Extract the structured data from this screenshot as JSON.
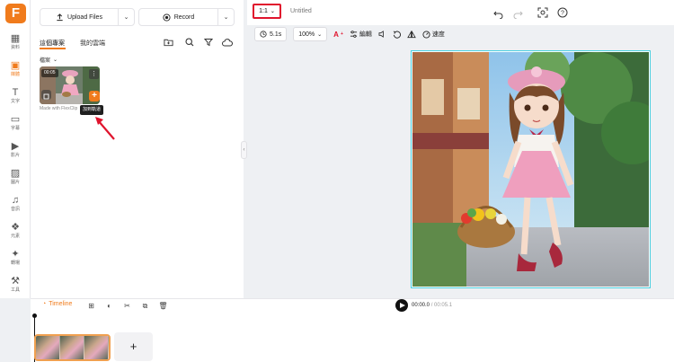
{
  "app": {
    "logo_letter": "F",
    "accent": "#f07b1c"
  },
  "rail": {
    "items": [
      {
        "icon": "grid-icon",
        "label": "資料",
        "glyph": "▦"
      },
      {
        "icon": "folder-icon",
        "label": "媒體",
        "glyph": "▣"
      },
      {
        "icon": "text-icon",
        "label": "文字",
        "glyph": "T"
      },
      {
        "icon": "subtitle-icon",
        "label": "字幕",
        "glyph": "▭"
      },
      {
        "icon": "video-icon",
        "label": "影片",
        "glyph": "▶"
      },
      {
        "icon": "image-icon",
        "label": "圖片",
        "glyph": "▨"
      },
      {
        "icon": "music-icon",
        "label": "音訊",
        "glyph": "♫"
      },
      {
        "icon": "elements-icon",
        "label": "元素",
        "glyph": "❖"
      },
      {
        "icon": "effects-icon",
        "label": "轉場",
        "glyph": "✦"
      },
      {
        "icon": "tools-icon",
        "label": "工具",
        "glyph": "⚒"
      }
    ]
  },
  "media": {
    "upload_label": "Upload Files",
    "record_label": "Record",
    "tabs": [
      "這個專案",
      "我的雲端"
    ],
    "filter_label": "檔案",
    "thumb_duration": "00:05",
    "thumb_caption": "Made with FlexClip",
    "tooltip": "加到軌道"
  },
  "topbar": {
    "ratio": "1:1",
    "title": "Untitled"
  },
  "toolbar": {
    "duration": "5.1s",
    "zoom": "100%",
    "edit_label": "編輯",
    "speed_label": "速度"
  },
  "timeline": {
    "label": "Timeline",
    "current": "00:00.0",
    "total": "/ 00:05.1",
    "add_label": "+"
  }
}
